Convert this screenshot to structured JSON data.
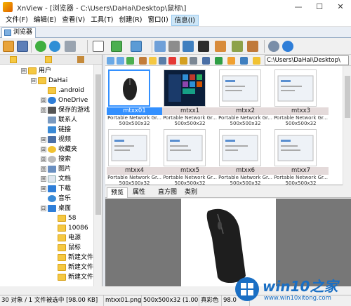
{
  "window": {
    "title": "XnView - [浏览器 - C:\\Users\\DaHai\\Desktop\\鼠标\\]",
    "minimize": "—",
    "maximize": "☐",
    "close": "✕"
  },
  "menu": [
    "文件(F)",
    "编辑(E)",
    "查看(V)",
    "工具(T)",
    "创建(R)",
    "窗口(I)",
    "信息(I)"
  ],
  "tab": {
    "label": "浏览器"
  },
  "path": {
    "value": "C:\\Users\\DaHai\\Desktop\\"
  },
  "tree": {
    "nodes": [
      {
        "label": "用户",
        "expander": "⊟"
      },
      {
        "label": "DaHai",
        "expander": "⊟"
      },
      {
        "label": ".android",
        "expander": ""
      },
      {
        "label": "OneDrive",
        "expander": "⊞"
      },
      {
        "label": "保存的游戏",
        "expander": "⊞"
      },
      {
        "label": "联系人",
        "expander": ""
      },
      {
        "label": "链接",
        "expander": ""
      },
      {
        "label": "视频",
        "expander": "⊞"
      },
      {
        "label": "收藏夹",
        "expander": "⊞"
      },
      {
        "label": "搜索",
        "expander": "⊞"
      },
      {
        "label": "图片",
        "expander": "⊞"
      },
      {
        "label": "文档",
        "expander": "⊞"
      },
      {
        "label": "下载",
        "expander": "⊞"
      },
      {
        "label": "音乐",
        "expander": ""
      },
      {
        "label": "桌面",
        "expander": "⊟"
      },
      {
        "label": "58",
        "expander": ""
      },
      {
        "label": "10086",
        "expander": ""
      },
      {
        "label": "电源",
        "expander": ""
      },
      {
        "label": "鼠标",
        "expander": ""
      },
      {
        "label": "新建文件",
        "expander": ""
      },
      {
        "label": "新建文件",
        "expander": ""
      },
      {
        "label": "新建文件",
        "expander": ""
      }
    ]
  },
  "thumbnails": [
    {
      "name": "mtxx01",
      "type": "Portable Network Gr...",
      "size": "500x500x32",
      "selected": true
    },
    {
      "name": "mtxx1",
      "type": "Portable Network Gr...",
      "size": "500x500x32",
      "selected": false
    },
    {
      "name": "mtxx2",
      "type": "Portable Network Gr...",
      "size": "500x500x32",
      "selected": false
    },
    {
      "name": "mtxx3",
      "type": "Portable Network Gr...",
      "size": "500x500x32",
      "selected": false
    },
    {
      "name": "mtxx4",
      "type": "Portable Network Gr...",
      "size": "500x500x32",
      "selected": false
    },
    {
      "name": "mtxx5",
      "type": "Portable Network Gr...",
      "size": "500x500x32",
      "selected": false
    },
    {
      "name": "mtxx6",
      "type": "Portable Network Gr...",
      "size": "500x500x32",
      "selected": false
    },
    {
      "name": "mtxx7",
      "type": "Portable Network Gr...",
      "size": "500x500x32",
      "selected": false
    }
  ],
  "preview_tabs": [
    "预览",
    "属性",
    "直方图",
    "类别"
  ],
  "status": {
    "count": "30 对象 / 1 文件被选中 [98.00 KB]",
    "file": "mtxx01.png",
    "dims": "500x500x32 (1.00)",
    "color": "真彩色",
    "size": "98.0"
  },
  "watermark": {
    "brand": "win10之家",
    "url": "www.win10xitong.com"
  }
}
